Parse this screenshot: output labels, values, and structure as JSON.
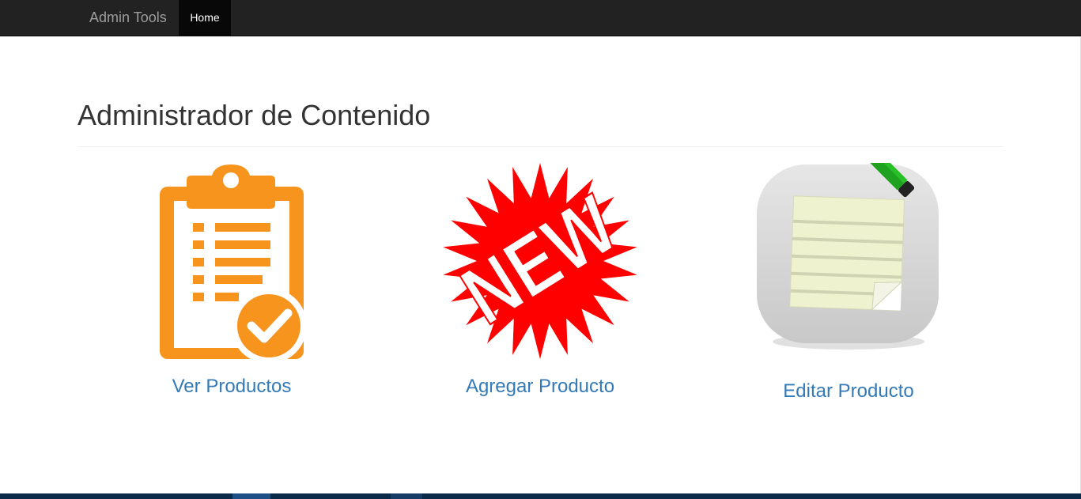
{
  "navbar": {
    "brand": "Admin Tools",
    "items": [
      {
        "label": "Home",
        "active": true
      }
    ]
  },
  "page": {
    "title": "Administrador de Contenido"
  },
  "tiles": [
    {
      "label": "Ver Productos",
      "icon": "clipboard-check-icon",
      "color": "#f7941d"
    },
    {
      "label": "Agregar Producto",
      "icon": "new-starburst-icon",
      "color": "#ff0000"
    },
    {
      "label": "Editar Producto",
      "icon": "notepad-pencil-icon",
      "color": "#00a000"
    }
  ],
  "colors": {
    "navbar_bg": "#222222",
    "link": "#337ab7",
    "taskbar": "#0b2a4a"
  }
}
